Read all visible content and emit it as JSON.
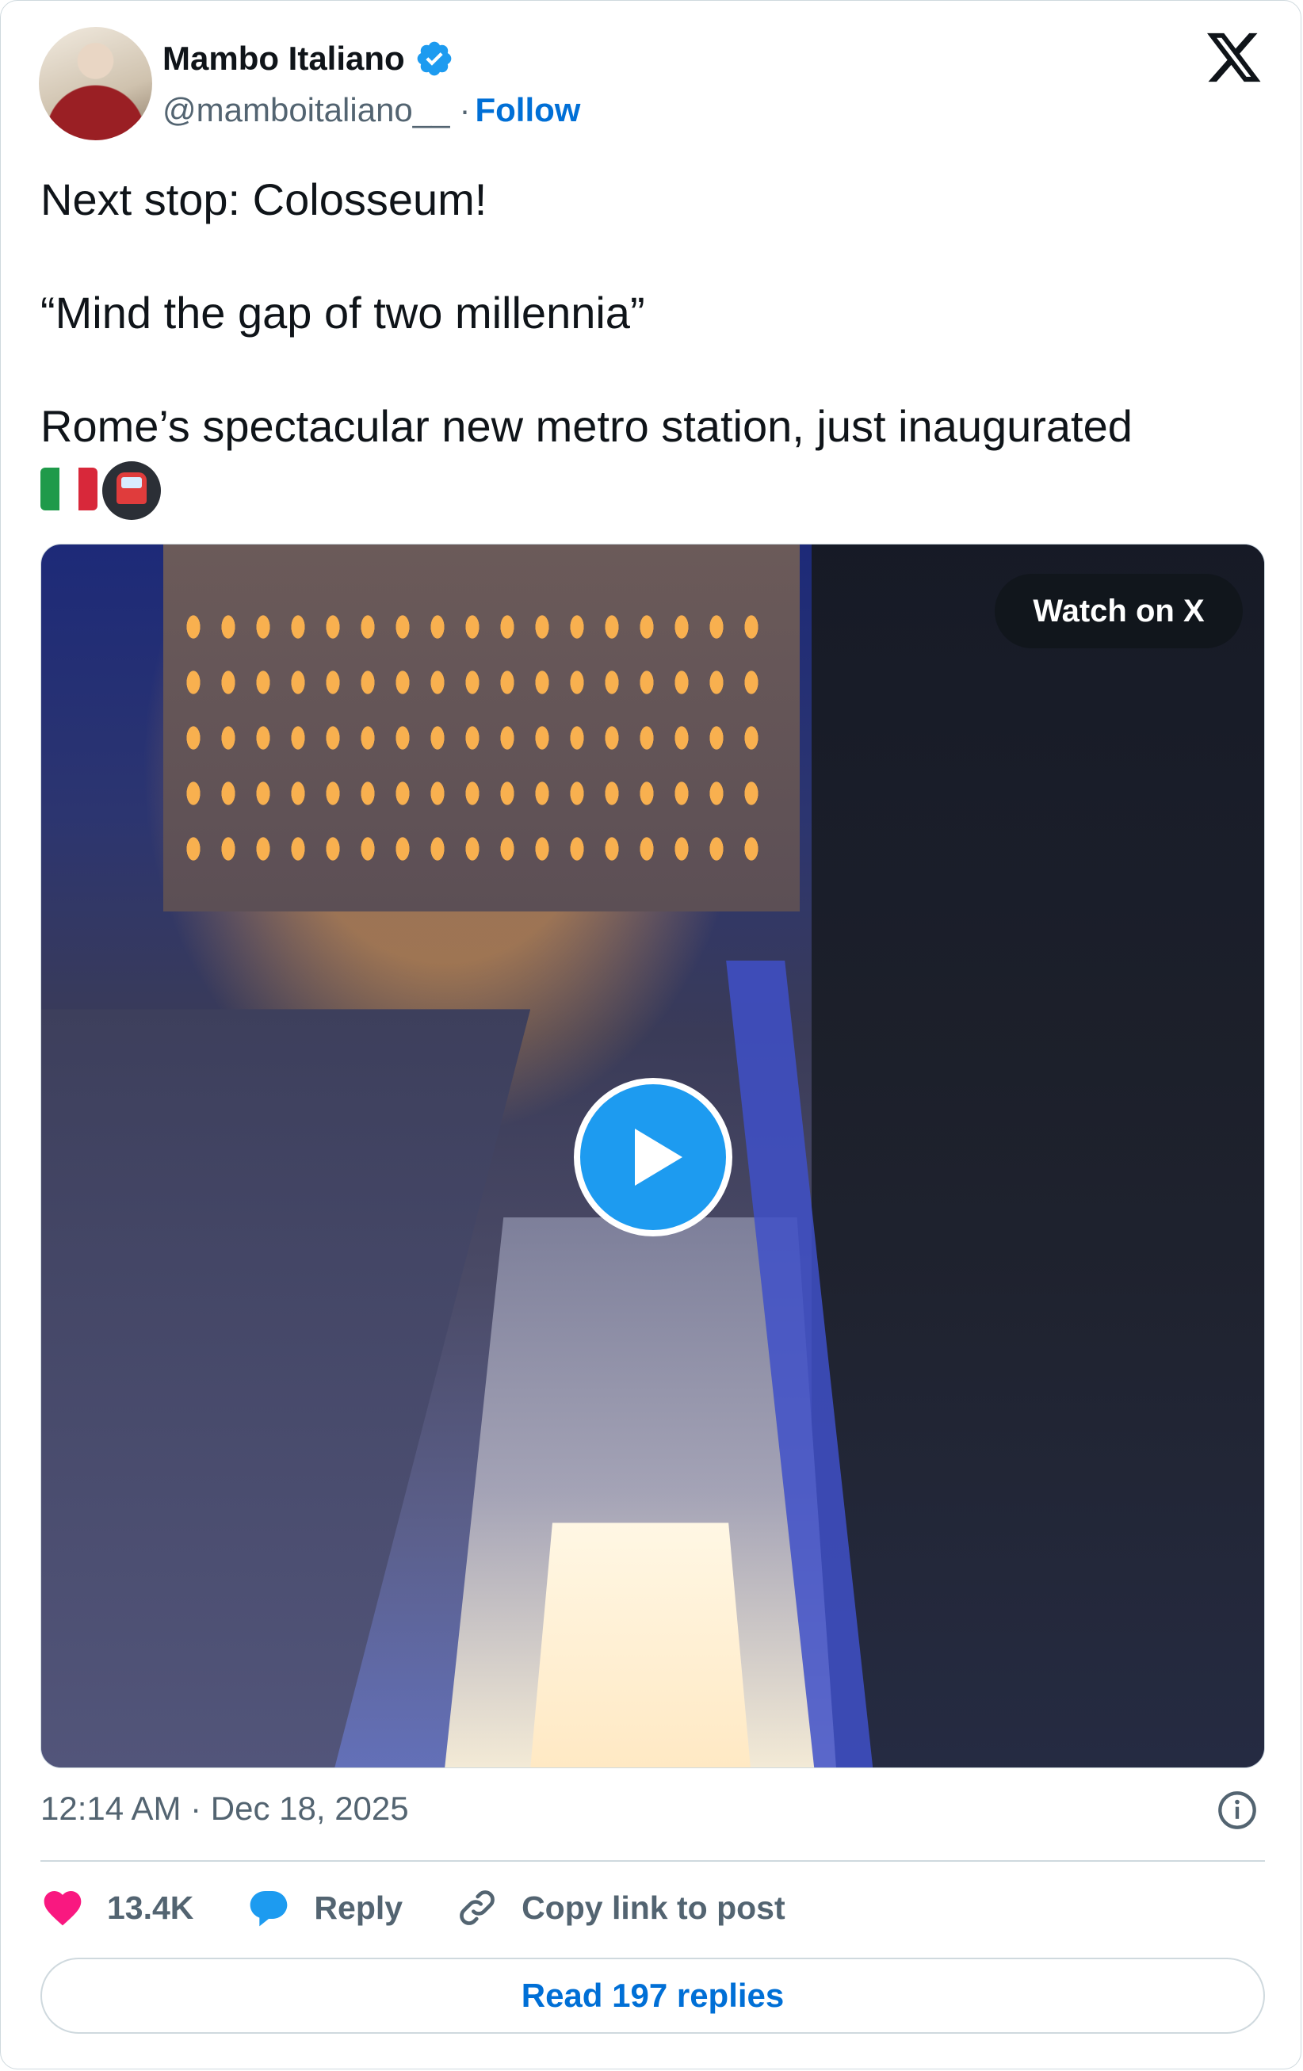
{
  "author": {
    "name": "Mambo Italiano",
    "handle": "@mamboitaliano__",
    "separator": "·",
    "follow_label": "Follow",
    "verified_icon": "verified-badge-icon",
    "verified_color": "#1d9bf0"
  },
  "platform_icon": "x-logo-icon",
  "tweet": {
    "line1": "Next stop: Colosseum!",
    "line2": "“Mind the gap of two millennia”",
    "line3": "Rome’s spectacular new metro station, just inaugurated",
    "emojis": [
      "italy-flag-icon",
      "metro-icon"
    ]
  },
  "media": {
    "watch_label": "Watch on X",
    "play_icon": "play-icon",
    "play_color": "#1d9bf0"
  },
  "timestamp": "12:14 AM · Dec 18, 2025",
  "actions": {
    "likes_count": "13.4K",
    "reply_label": "Reply",
    "copy_link_label": "Copy link to post",
    "like_color": "#f91880",
    "reply_color": "#1d9bf0"
  },
  "read_replies_label": "Read 197 replies"
}
